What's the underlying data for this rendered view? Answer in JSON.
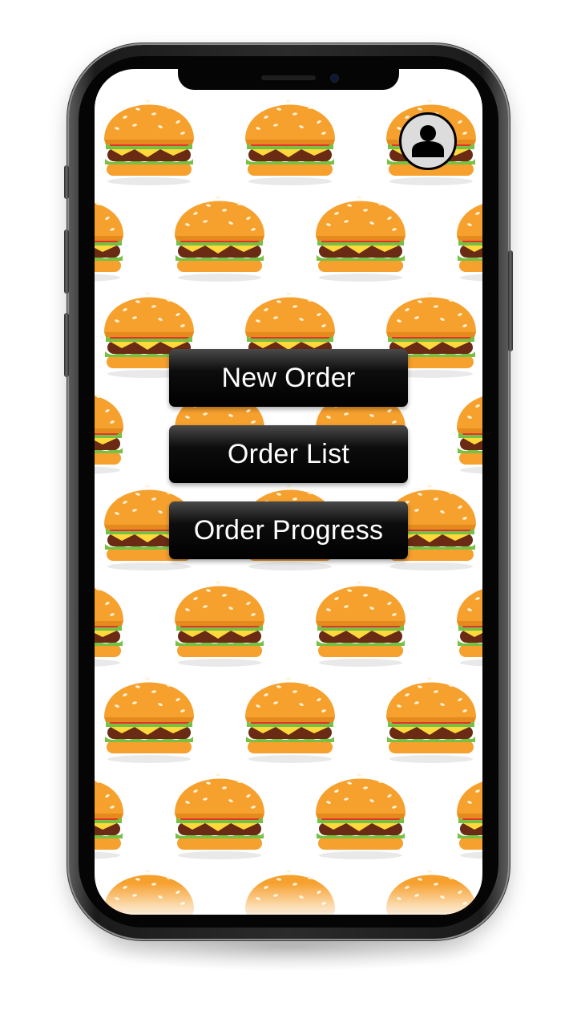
{
  "menu": {
    "new_order_label": "New Order",
    "order_list_label": "Order List",
    "order_progress_label": "Order Progress"
  },
  "profile": {
    "icon": "user-avatar-icon"
  },
  "background": {
    "pattern_icon": "burger-icon"
  },
  "colors": {
    "button_bg": "#000000",
    "button_text": "#ffffff",
    "profile_bg": "#dcdcdc",
    "bun": "#f6a02e",
    "cheese": "#ffd93b",
    "patty": "#6b2a14",
    "lettuce": "#76c043",
    "tomato": "#e5322d"
  }
}
